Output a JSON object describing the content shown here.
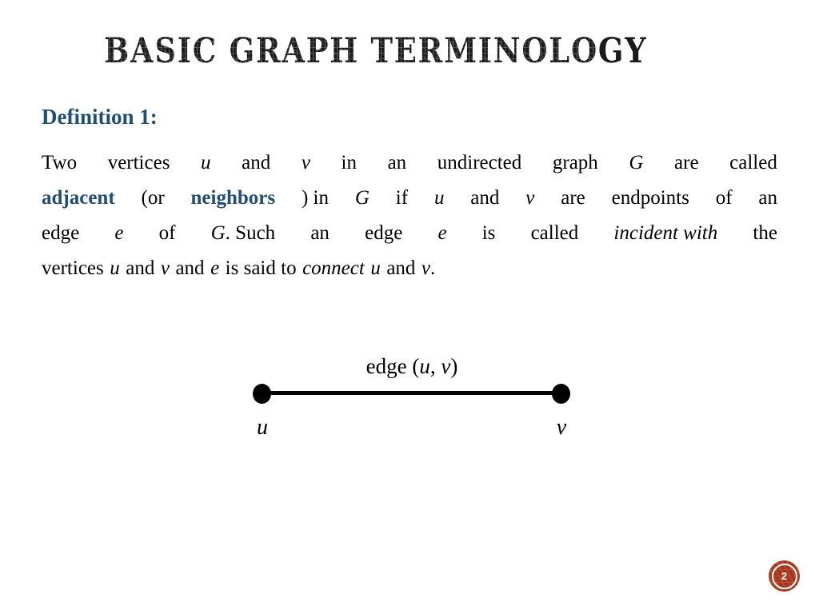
{
  "slide": {
    "title": "Basic Graph Terminology",
    "background_color": "#FFFFFF",
    "accent_blue": "#1F4E79",
    "badge_color": "#A8341A"
  },
  "definition": {
    "heading": "Definition 1:",
    "lines": [
      {
        "id": "line1",
        "justified": true,
        "tokens": [
          {
            "text": "Two",
            "style": "normal"
          },
          {
            "text": "vertices",
            "style": "normal"
          },
          {
            "text": "u",
            "style": "italic"
          },
          {
            "text": "and",
            "style": "normal"
          },
          {
            "text": "v",
            "style": "italic"
          },
          {
            "text": "in",
            "style": "normal"
          },
          {
            "text": "an",
            "style": "normal"
          },
          {
            "text": "undirected",
            "style": "normal"
          },
          {
            "text": "graph",
            "style": "normal"
          },
          {
            "text": "G",
            "style": "italic"
          },
          {
            "text": "are",
            "style": "normal"
          },
          {
            "text": "called",
            "style": "normal"
          }
        ]
      },
      {
        "id": "line2",
        "justified": true,
        "tokens": [
          {
            "text": "adjacent",
            "style": "bold-blue"
          },
          {
            "text": "(or",
            "style": "normal"
          },
          {
            "text": "neighbors",
            "style": "bold-blue"
          },
          {
            "text": ")",
            "style": "normal"
          },
          {
            "text": "in",
            "style": "normal"
          },
          {
            "text": "G",
            "style": "italic"
          },
          {
            "text": "if",
            "style": "normal"
          },
          {
            "text": "u",
            "style": "italic"
          },
          {
            "text": "and",
            "style": "normal"
          },
          {
            "text": "v",
            "style": "italic"
          },
          {
            "text": "are",
            "style": "normal"
          },
          {
            "text": "endpoints",
            "style": "normal"
          },
          {
            "text": "of",
            "style": "normal"
          },
          {
            "text": "an",
            "style": "normal"
          }
        ]
      },
      {
        "id": "line3",
        "justified": true,
        "tokens": [
          {
            "text": "edge",
            "style": "normal"
          },
          {
            "text": "e",
            "style": "italic"
          },
          {
            "text": "of",
            "style": "normal"
          },
          {
            "text": "G.",
            "style": "italic-period"
          },
          {
            "text": "Such",
            "style": "normal"
          },
          {
            "text": "an",
            "style": "normal"
          },
          {
            "text": "edge",
            "style": "normal"
          },
          {
            "text": "e",
            "style": "italic"
          },
          {
            "text": "is",
            "style": "normal"
          },
          {
            "text": "called",
            "style": "normal"
          },
          {
            "text": "incident",
            "style": "italic"
          },
          {
            "text": "with",
            "style": "italic"
          },
          {
            "text": "the",
            "style": "normal"
          }
        ]
      },
      {
        "id": "line4",
        "justified": false,
        "tokens": [
          {
            "text": "vertices",
            "style": "normal"
          },
          {
            "text": "u",
            "style": "italic"
          },
          {
            "text": "and",
            "style": "normal"
          },
          {
            "text": "v",
            "style": "italic"
          },
          {
            "text": "and",
            "style": "normal"
          },
          {
            "text": "e",
            "style": "italic"
          },
          {
            "text": "is",
            "style": "normal"
          },
          {
            "text": "said",
            "style": "normal"
          },
          {
            "text": "to",
            "style": "normal"
          },
          {
            "text": "connect",
            "style": "italic"
          },
          {
            "text": "u",
            "style": "italic"
          },
          {
            "text": "and",
            "style": "normal"
          },
          {
            "text": "v.",
            "style": "italic-period"
          }
        ]
      }
    ],
    "segments": {
      "l1a": "Two",
      "l1b": "vertices",
      "l1c": "u",
      "l1d": "and",
      "l1e": "v",
      "l1f": "in",
      "l1g": "an",
      "l1h": "undirected",
      "l1i": "graph",
      "l1j": "G",
      "l1k": "are",
      "l1l": "called",
      "l2a": "adjacent",
      "l2b": "(or",
      "l2c": "neighbors",
      "l2d": ") in",
      "l2e": "G",
      "l2f": "if",
      "l2g": "u",
      "l2h": "and",
      "l2i": "v",
      "l2j": "are",
      "l2k": "endpoints",
      "l2l": "of",
      "l2m": "an",
      "l3a": "edge",
      "l3b": "e",
      "l3c": "of",
      "l3d": "G",
      "l3e": ". Such",
      "l3f": "an",
      "l3g": "edge",
      "l3h": "e",
      "l3i": "is",
      "l3j": "called",
      "l3k": "incident with",
      "l3l": "the",
      "l4a": "vertices",
      "l4b": "u",
      "l4c": "and",
      "l4d": "v",
      "l4e": "and",
      "l4f": "e",
      "l4g": "is said to",
      "l4h": "connect",
      "l4i": "u",
      "l4j": "and",
      "l4k": "v",
      "l4l": "."
    }
  },
  "figure": {
    "edge_label_prefix": "edge",
    "edge_label_pair": "(u, v)",
    "edge_label_open": "(",
    "edge_label_u": "u",
    "edge_label_comma": ", ",
    "edge_label_v": "v",
    "edge_label_close": ")",
    "vertex_left_label": "u",
    "vertex_right_label": "v",
    "edge_color": "#000000",
    "vertex_color": "#000000"
  },
  "footer": {
    "page_number": "2"
  }
}
